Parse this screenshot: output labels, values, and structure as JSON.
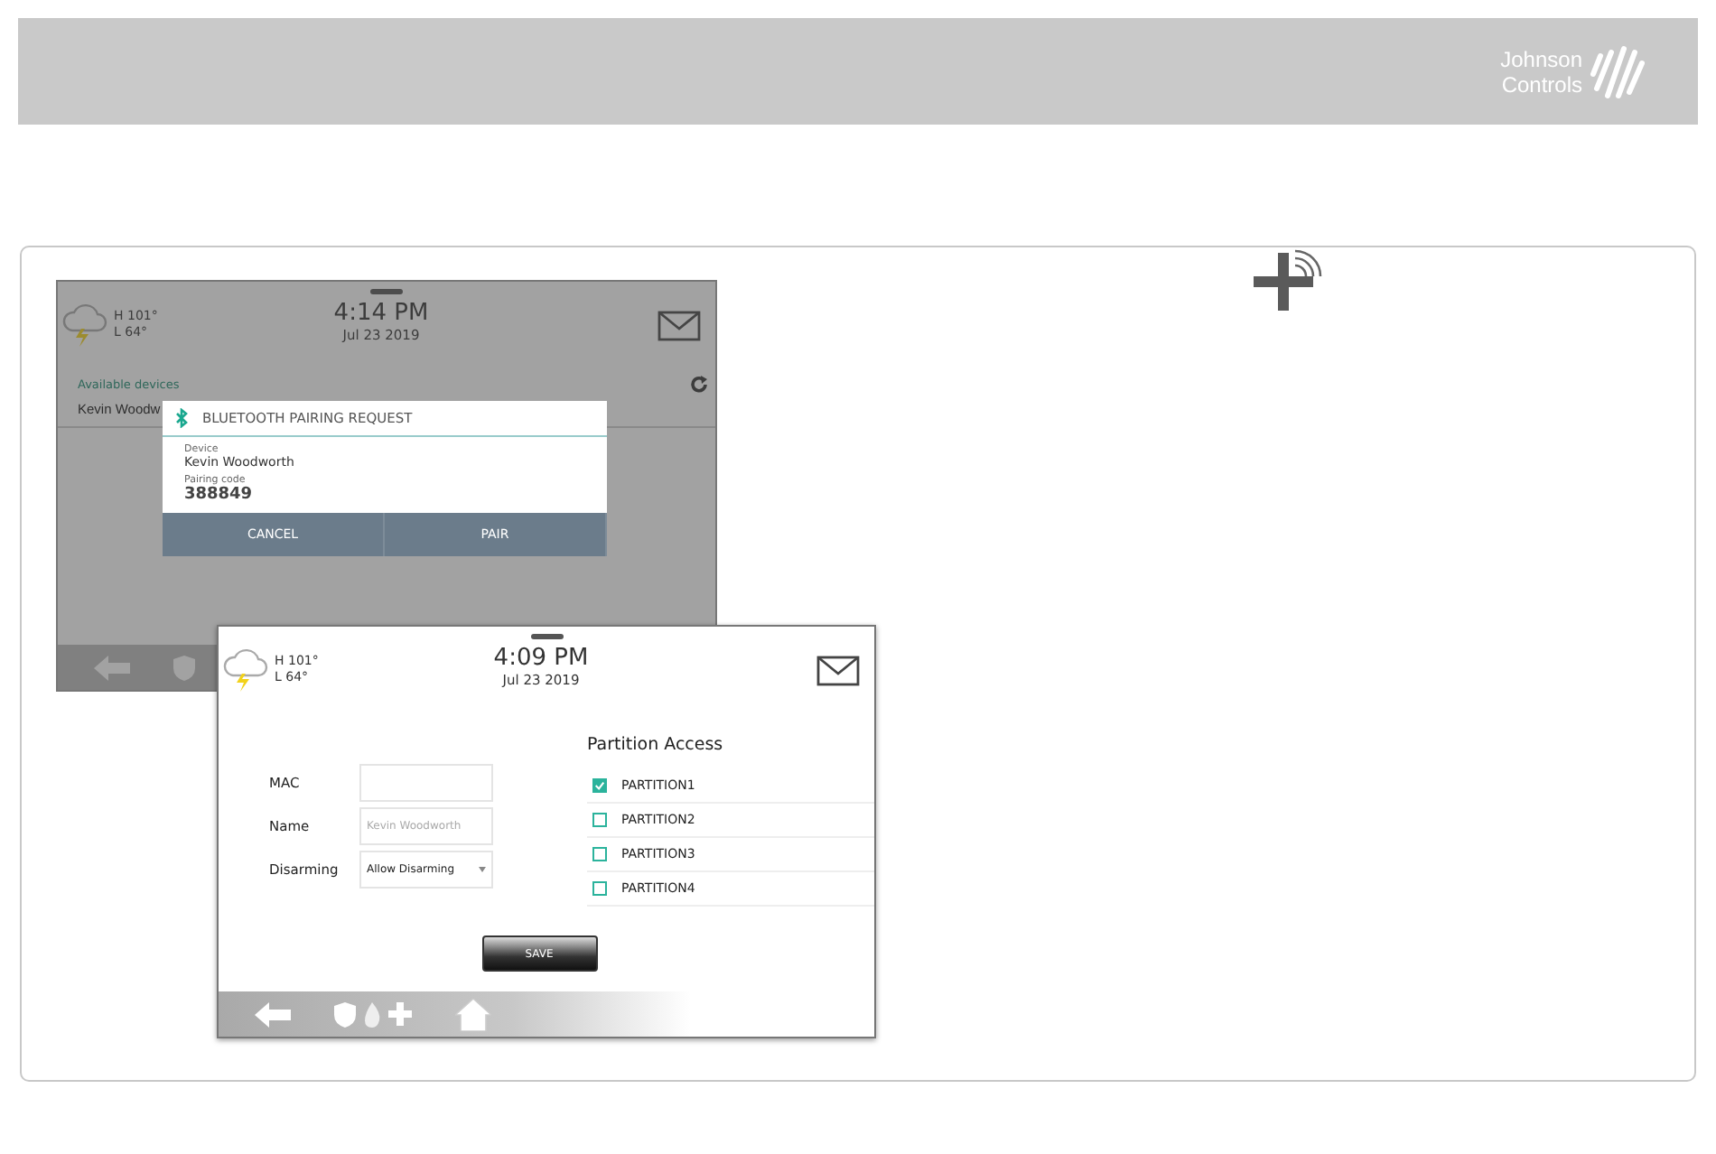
{
  "header": {
    "logo_lines": [
      "Johnson",
      "Controls"
    ]
  },
  "back_screen": {
    "weather": {
      "high": "H 101°",
      "low": "L 64°"
    },
    "time": "4:14 PM",
    "date": "Jul 23 2019",
    "section_label": "Available devices",
    "devices": [
      "Kevin Woodw"
    ],
    "dialog": {
      "title": "BLUETOOTH PAIRING REQUEST",
      "fields": [
        {
          "label": "Device",
          "value": "Kevin Woodworth"
        },
        {
          "label": "Pairing code",
          "value": "388849"
        }
      ],
      "buttons": [
        "CANCEL",
        "PAIR"
      ]
    }
  },
  "front_screen": {
    "weather": {
      "high": "H 101°",
      "low": "L 64°"
    },
    "time": "4:09 PM",
    "date": "Jul 23 2019",
    "form": [
      {
        "kind": "text",
        "label": "MAC"
      },
      {
        "kind": "text",
        "label": "Name",
        "placeholder": "Kevin Woodworth"
      },
      {
        "kind": "dropdown",
        "label": "Disarming",
        "value": "Allow Disarming"
      }
    ],
    "partition_access": {
      "title": "Partition Access",
      "items": [
        {
          "label": "PARTITION1",
          "checked": true
        },
        {
          "label": "PARTITION2",
          "checked": false
        },
        {
          "label": "PARTITION3",
          "checked": false
        },
        {
          "label": "PARTITION4",
          "checked": false
        }
      ]
    },
    "save_button": "SAVE"
  }
}
